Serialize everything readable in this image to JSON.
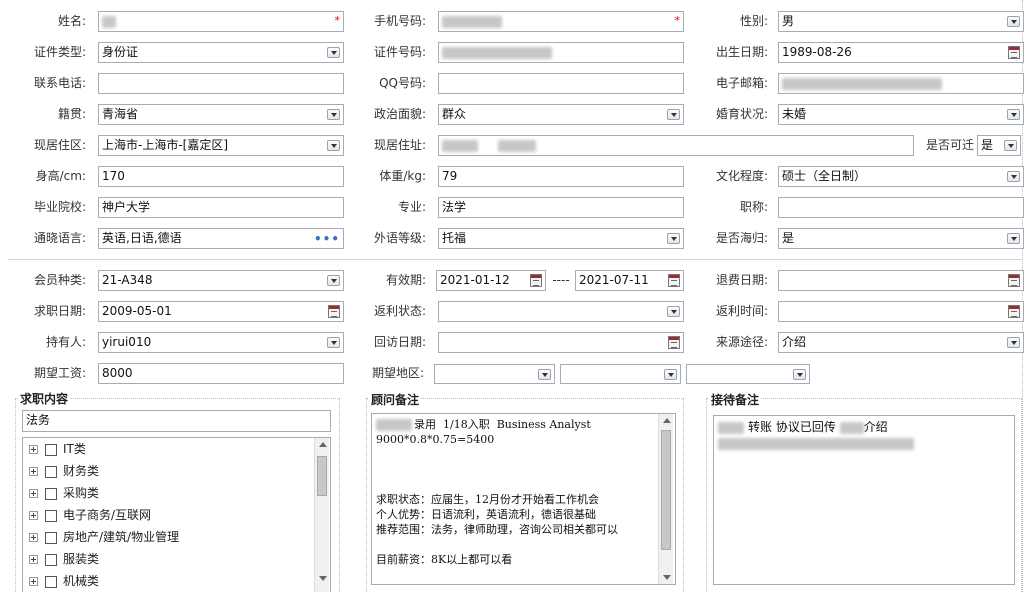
{
  "basic": {
    "name": {
      "label": "姓名:",
      "value": ""
    },
    "phone": {
      "label": "手机号码:",
      "value": ""
    },
    "gender": {
      "label": "性别:",
      "value": "男"
    },
    "id_type": {
      "label": "证件类型:",
      "value": "身份证"
    },
    "id_number": {
      "label": "证件号码:",
      "value": ""
    },
    "birth_date": {
      "label": "出生日期:",
      "value": "1989-08-26"
    },
    "contact_phone": {
      "label": "联系电话:",
      "value": ""
    },
    "qq": {
      "label": "QQ号码:",
      "value": ""
    },
    "email": {
      "label": "电子邮箱:",
      "value": ""
    },
    "native_place": {
      "label": "籍贯:",
      "value": "青海省"
    },
    "political_status": {
      "label": "政治面貌:",
      "value": "群众"
    },
    "marital_status": {
      "label": "婚育状况:",
      "value": "未婚"
    },
    "current_area": {
      "label": "现居住区:",
      "value": "上海市-上海市-[嘉定区]"
    },
    "current_address": {
      "label": "现居住址:",
      "value": ""
    },
    "relocatable": {
      "label": "是否可迁",
      "value": "是"
    },
    "height": {
      "label": "身高/cm:",
      "value": "170"
    },
    "weight": {
      "label": "体重/kg:",
      "value": "79"
    },
    "education": {
      "label": "文化程度:",
      "value": "硕士（全日制）"
    },
    "school": {
      "label": "毕业院校:",
      "value": "神户大学"
    },
    "major": {
      "label": "专业:",
      "value": "法学"
    },
    "title": {
      "label": "职称:",
      "value": ""
    },
    "languages": {
      "label": "通晓语言:",
      "value": "英语,日语,德语"
    },
    "language_level": {
      "label": "外语等级:",
      "value": "托福"
    },
    "overseas_returnee": {
      "label": "是否海归:",
      "value": "是"
    }
  },
  "membership": {
    "member_type": {
      "label": "会员种类:",
      "value": "21-A348"
    },
    "valid_period": {
      "label": "有效期:",
      "start": "2021-01-12",
      "separator": "----",
      "end": "2021-07-11"
    },
    "refund_date": {
      "label": "退费日期:",
      "value": ""
    },
    "job_search_date": {
      "label": "求职日期:",
      "value": "2009-05-01"
    },
    "rebate_status": {
      "label": "返利状态:",
      "value": ""
    },
    "rebate_time": {
      "label": "返利时间:",
      "value": ""
    },
    "holder": {
      "label": "持有人:",
      "value": "yirui010"
    },
    "revisit_date": {
      "label": "回访日期:",
      "value": ""
    },
    "source": {
      "label": "来源途径:",
      "value": "介绍"
    },
    "expected_salary": {
      "label": "期望工资:",
      "value": "8000"
    },
    "expected_area": {
      "label": "期望地区:",
      "value1": "",
      "value2": "",
      "value3": ""
    }
  },
  "job_content": {
    "title": "求职内容",
    "selected": "法务",
    "tree": [
      "IT类",
      "财务类",
      "采购类",
      "电子商务/互联网",
      "房地产/建筑/物业管理",
      "服装类",
      "机械类"
    ]
  },
  "consultant_notes": {
    "title": "顾问备注",
    "lines": [
      "录用  1/18入职  Business Analyst",
      "9000*0.8*0.75=5400",
      "",
      "",
      "",
      "求职状态：应届生，12月份才开始看工作机会",
      "个人优势：日语流利，英语流利，德语很基础",
      "推荐范围：法务，律师助理，咨询公司相关都可以",
      "",
      "目前薪资：8K以上都可以看"
    ]
  },
  "reception_notes": {
    "title": "接待备注",
    "line1_a": "转账 协议已回传",
    "line1_b": "介绍"
  },
  "colors": {
    "required": "#dd0000",
    "border": "#a5acb5",
    "link": "#3a6fc4"
  }
}
